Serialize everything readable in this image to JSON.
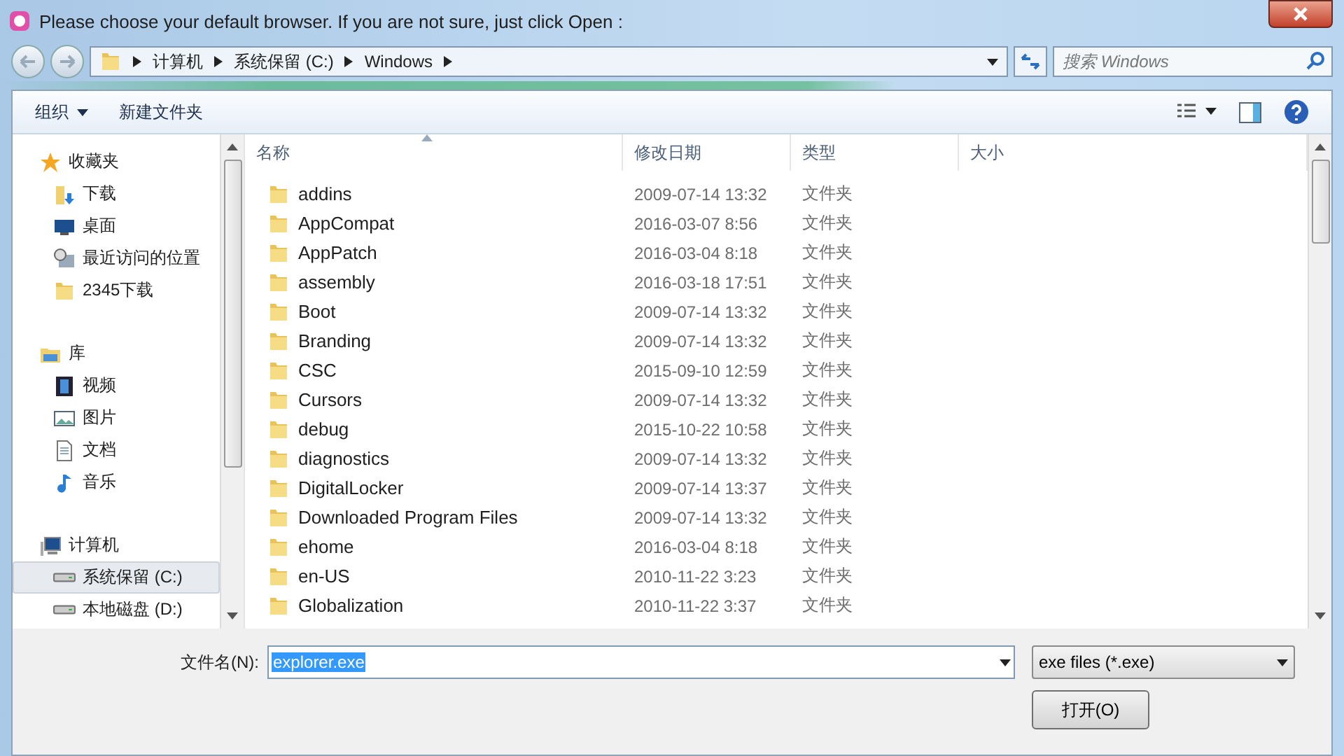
{
  "window": {
    "title": "Please choose your default browser. If you are not sure, just click Open :"
  },
  "address_bar": {
    "path": [
      "计算机",
      "系统保留 (C:)",
      "Windows"
    ]
  },
  "search": {
    "placeholder": "搜索 Windows"
  },
  "toolbar": {
    "organize": "组织",
    "new_folder": "新建文件夹"
  },
  "sidebar": {
    "groups": [
      {
        "label": "收藏夹",
        "kind": "star",
        "children": [
          {
            "label": "下载",
            "kind": "download",
            "selected": false
          },
          {
            "label": "桌面",
            "kind": "desktop",
            "selected": false
          },
          {
            "label": "最近访问的位置",
            "kind": "recent",
            "selected": false
          },
          {
            "label": "2345下载",
            "kind": "folder",
            "selected": false
          }
        ]
      },
      {
        "label": "库",
        "kind": "library",
        "children": [
          {
            "label": "视频",
            "kind": "video",
            "selected": false
          },
          {
            "label": "图片",
            "kind": "image",
            "selected": false
          },
          {
            "label": "文档",
            "kind": "document",
            "selected": false
          },
          {
            "label": "音乐",
            "kind": "music",
            "selected": false
          }
        ]
      },
      {
        "label": "计算机",
        "kind": "computer",
        "children": [
          {
            "label": "系统保留 (C:)",
            "kind": "drive",
            "selected": true
          },
          {
            "label": "本地磁盘 (D:)",
            "kind": "drive",
            "selected": false
          }
        ]
      }
    ]
  },
  "table": {
    "columns": [
      "名称",
      "修改日期",
      "类型",
      "大小"
    ],
    "rows": [
      {
        "name": "addins",
        "date": "2009-07-14 13:32",
        "type": "文件夹"
      },
      {
        "name": "AppCompat",
        "date": "2016-03-07 8:56",
        "type": "文件夹"
      },
      {
        "name": "AppPatch",
        "date": "2016-03-04 8:18",
        "type": "文件夹"
      },
      {
        "name": "assembly",
        "date": "2016-03-18 17:51",
        "type": "文件夹"
      },
      {
        "name": "Boot",
        "date": "2009-07-14 13:32",
        "type": "文件夹"
      },
      {
        "name": "Branding",
        "date": "2009-07-14 13:32",
        "type": "文件夹"
      },
      {
        "name": "CSC",
        "date": "2015-09-10 12:59",
        "type": "文件夹"
      },
      {
        "name": "Cursors",
        "date": "2009-07-14 13:32",
        "type": "文件夹"
      },
      {
        "name": "debug",
        "date": "2015-10-22 10:58",
        "type": "文件夹"
      },
      {
        "name": "diagnostics",
        "date": "2009-07-14 13:32",
        "type": "文件夹"
      },
      {
        "name": "DigitalLocker",
        "date": "2009-07-14 13:37",
        "type": "文件夹"
      },
      {
        "name": "Downloaded Program Files",
        "date": "2009-07-14 13:32",
        "type": "文件夹"
      },
      {
        "name": "ehome",
        "date": "2016-03-04 8:18",
        "type": "文件夹"
      },
      {
        "name": "en-US",
        "date": "2010-11-22 3:23",
        "type": "文件夹"
      },
      {
        "name": "Globalization",
        "date": "2010-11-22 3:37",
        "type": "文件夹"
      }
    ]
  },
  "bottom": {
    "filename_label": "文件名(N):",
    "filename": "explorer.exe",
    "filter": "exe files (*.exe)",
    "open_button": "打开(O)"
  }
}
